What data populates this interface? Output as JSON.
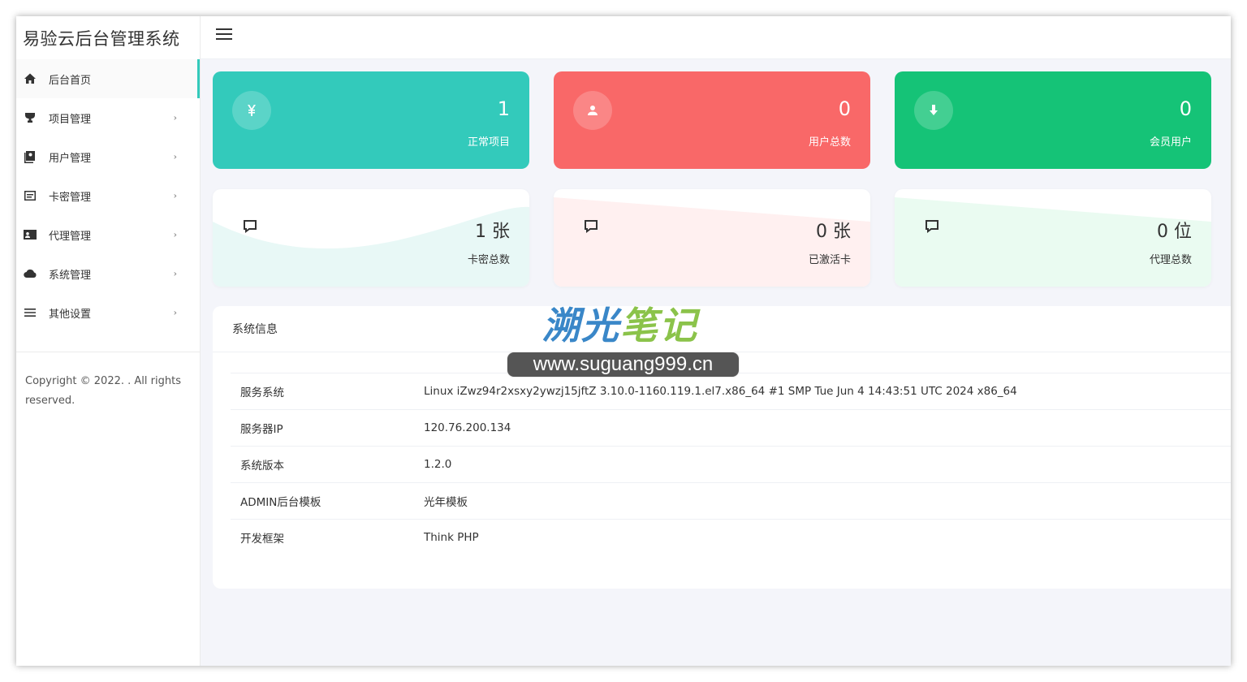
{
  "app": {
    "title": "易验云后台管理系统"
  },
  "sidebar": {
    "items": [
      {
        "label": "后台首页",
        "icon": "home-icon",
        "active": true
      },
      {
        "label": "项目管理",
        "icon": "trophy-icon"
      },
      {
        "label": "用户管理",
        "icon": "user-card-icon"
      },
      {
        "label": "卡密管理",
        "icon": "card-icon"
      },
      {
        "label": "代理管理",
        "icon": "id-card-icon"
      },
      {
        "label": "系统管理",
        "icon": "cloud-icon"
      },
      {
        "label": "其他设置",
        "icon": "list-icon"
      }
    ],
    "copyright": "Copyright © 2022. . All rights reserved."
  },
  "stats_top": [
    {
      "value": "1",
      "label": "正常项目",
      "color": "#33cabb",
      "icon": "yen-icon"
    },
    {
      "value": "0",
      "label": "用户总数",
      "color": "#f96868",
      "icon": "user-icon"
    },
    {
      "value": "0",
      "label": "会员用户",
      "color": "#15c377",
      "icon": "download-icon"
    }
  ],
  "stats_bottom": [
    {
      "value": "1 张",
      "label": "卡密总数",
      "tint": "#e8f8f6",
      "icon": "comment-icon"
    },
    {
      "value": "0 张",
      "label": "已激活卡",
      "tint": "#fff0f0",
      "icon": "comment-icon"
    },
    {
      "value": "0 位",
      "label": "代理总数",
      "tint": "#eafbf1",
      "icon": "comment-icon"
    }
  ],
  "system_info": {
    "title": "系统信息",
    "rows": [
      {
        "key": "服务系统",
        "value": "Linux iZwz94r2xsxy2ywzj15jftZ 3.10.0-1160.119.1.el7.x86_64 #1 SMP Tue Jun 4 14:43:51 UTC 2024 x86_64"
      },
      {
        "key": "服务器IP",
        "value": "120.76.200.134"
      },
      {
        "key": "系统版本",
        "value": "1.2.0"
      },
      {
        "key": "ADMIN后台模板",
        "value": "光年模板"
      },
      {
        "key": "开发框架",
        "value": "Think PHP"
      }
    ]
  },
  "watermark": {
    "title_blue": "溯光",
    "title_green": "笔记",
    "url": "www.suguang999.cn"
  }
}
